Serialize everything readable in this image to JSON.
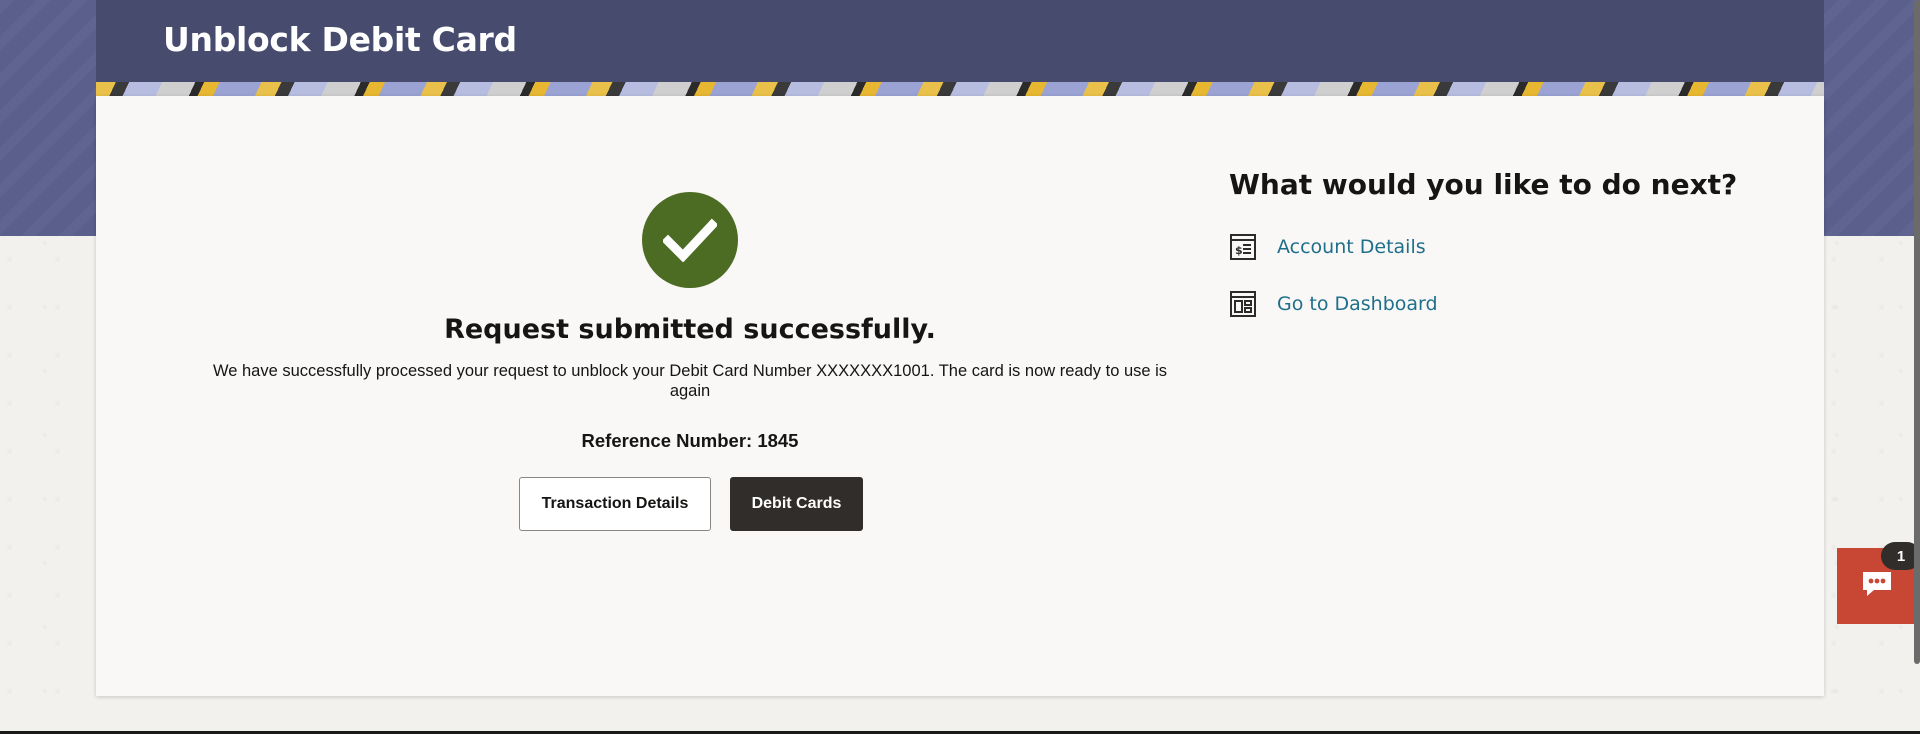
{
  "header": {
    "title": "Unblock Debit Card"
  },
  "confirmation": {
    "heading": "Request submitted successfully.",
    "message": "We have successfully processed your request to unblock your Debit Card Number XXXXXXX1001. The card is now ready to use is again",
    "reference_label": "Reference Number: 1845",
    "buttons": {
      "transaction_details": "Transaction Details",
      "debit_cards": "Debit Cards"
    }
  },
  "next_steps": {
    "heading": "What would you like to do next?",
    "links": [
      {
        "label": "Account Details",
        "icon": "account-details-icon"
      },
      {
        "label": "Go to Dashboard",
        "icon": "dashboard-icon"
      }
    ]
  },
  "chat": {
    "badge_count": "1",
    "icon": "chat-bubble-icon"
  },
  "colors": {
    "header_bg": "#474c6e",
    "band_bg": "#5a5f8c",
    "success_green": "#4b6c22",
    "link_blue": "#1f6f8b",
    "primary_button": "#312d2a",
    "chat_red": "#c74634"
  }
}
